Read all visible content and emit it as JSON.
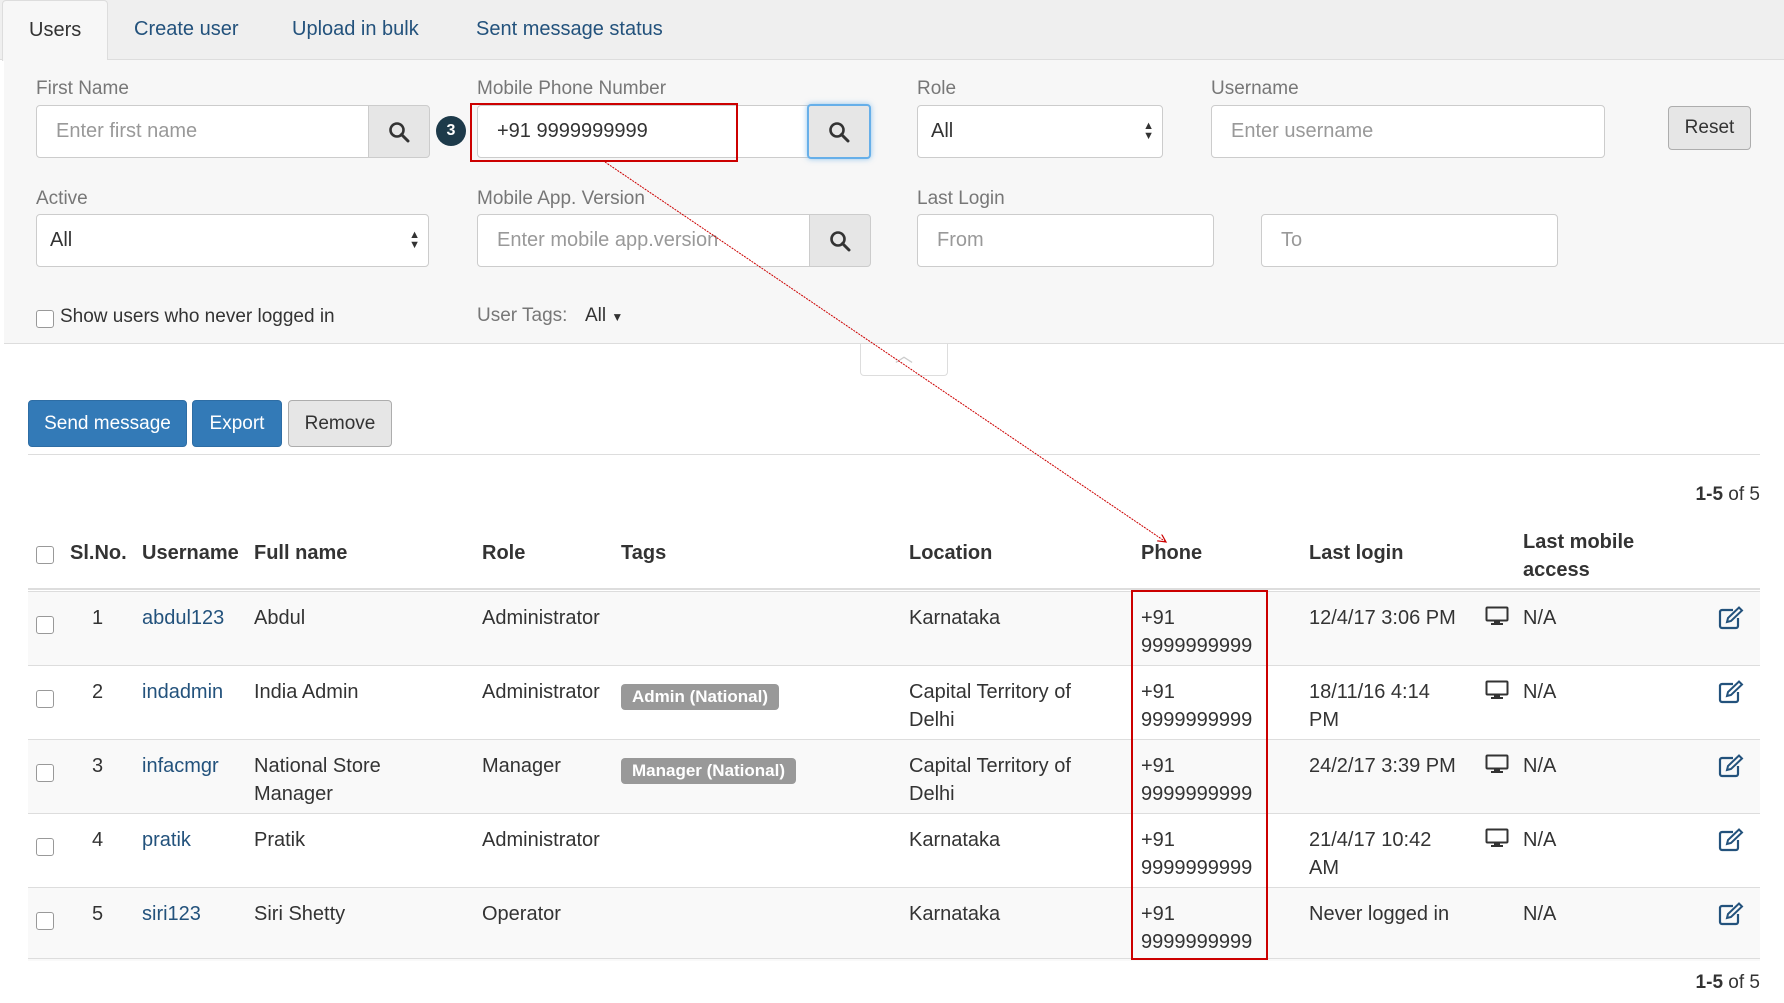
{
  "tabs": [
    "Users",
    "Create user",
    "Upload in bulk",
    "Sent message status"
  ],
  "filters": {
    "first_name": {
      "label": "First Name",
      "placeholder": "Enter first name"
    },
    "mobile_phone": {
      "label": "Mobile Phone Number",
      "value": "+91 9999999999"
    },
    "role": {
      "label": "Role",
      "value": "All"
    },
    "username": {
      "label": "Username",
      "placeholder": "Enter username"
    },
    "reset_label": "Reset",
    "active": {
      "label": "Active",
      "value": "All"
    },
    "app_version": {
      "label": "Mobile App. Version",
      "placeholder": "Enter mobile app.version"
    },
    "last_login": {
      "label": "Last Login",
      "from_placeholder": "From",
      "to_placeholder": "To"
    },
    "never_logged_label": "Show users who never logged in",
    "user_tags": {
      "label": "User Tags:",
      "value": "All"
    }
  },
  "callout_number": "3",
  "actions": {
    "send_message": "Send message",
    "export": "Export",
    "remove": "Remove"
  },
  "pagination": {
    "range": "1-5",
    "of_text": "of 5"
  },
  "table": {
    "headers": {
      "slno": "Sl.No.",
      "username": "Username",
      "full_name": "Full name",
      "role": "Role",
      "tags": "Tags",
      "location": "Location",
      "phone": "Phone",
      "last_login": "Last login",
      "last_mobile_1": "Last mobile",
      "last_mobile_2": "access"
    },
    "rows": [
      {
        "slno": "1",
        "username": "abdul123",
        "name1": "Abdul",
        "name2": "",
        "role": "Administrator",
        "tag": "",
        "loc1": "Karnataka",
        "loc2": "",
        "phone1": "+91",
        "phone2": "9999999999",
        "login1": "12/4/17 3:06 PM",
        "login2": "",
        "mobile": "N/A"
      },
      {
        "slno": "2",
        "username": "indadmin",
        "name1": "India Admin",
        "name2": "",
        "role": "Administrator",
        "tag": "Admin (National)",
        "loc1": "Capital Territory of",
        "loc2": "Delhi",
        "phone1": "+91",
        "phone2": "9999999999",
        "login1": "18/11/16 4:14",
        "login2": "PM",
        "mobile": "N/A"
      },
      {
        "slno": "3",
        "username": "infacmgr",
        "name1": "National Store",
        "name2": "Manager",
        "role": "Manager",
        "tag": "Manager (National)",
        "loc1": "Capital Territory of",
        "loc2": "Delhi",
        "phone1": "+91",
        "phone2": "9999999999",
        "login1": "24/2/17 3:39 PM",
        "login2": "",
        "mobile": "N/A"
      },
      {
        "slno": "4",
        "username": "pratik",
        "name1": "Pratik",
        "name2": "",
        "role": "Administrator",
        "tag": "",
        "loc1": "Karnataka",
        "loc2": "",
        "phone1": "+91",
        "phone2": "9999999999",
        "login1": "21/4/17 10:42",
        "login2": "AM",
        "mobile": "N/A"
      },
      {
        "slno": "5",
        "username": "siri123",
        "name1": "Siri Shetty",
        "name2": "",
        "role": "Operator",
        "tag": "",
        "loc1": "Karnataka",
        "loc2": "",
        "phone1": "+91",
        "phone2": "9999999999",
        "login1": "Never logged in",
        "login2": "",
        "mobile": "N/A"
      }
    ]
  }
}
